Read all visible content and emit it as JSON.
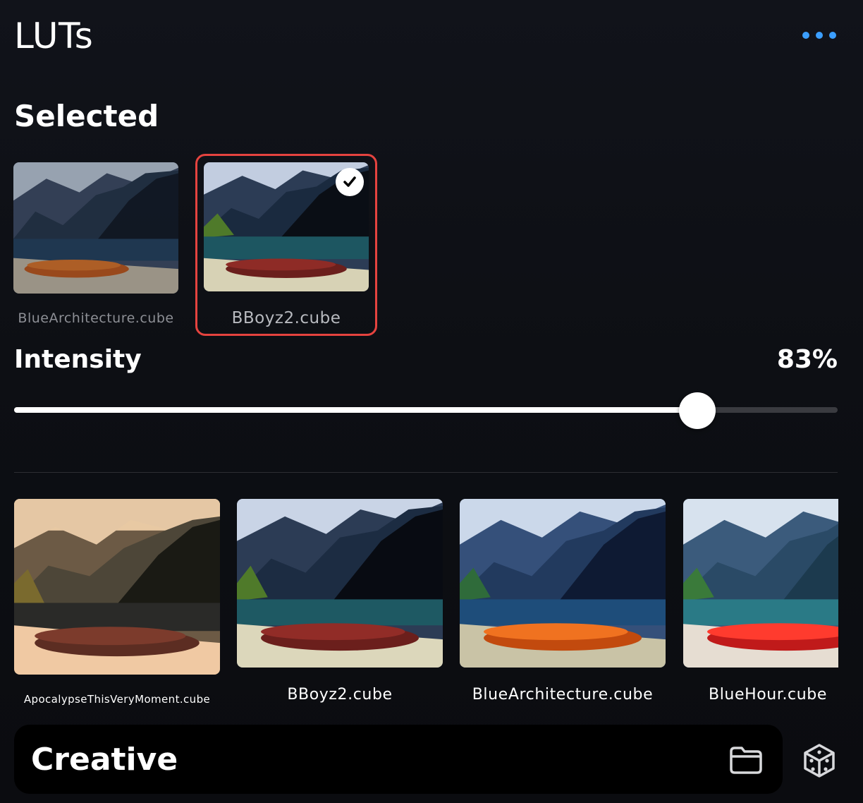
{
  "header": {
    "title": "LUTs",
    "more_icon": "ellipsis-icon"
  },
  "selected_section": {
    "title": "Selected",
    "items": [
      {
        "label": "BlueArchitecture.cube",
        "selected": false
      },
      {
        "label": "BBoyz2.cube",
        "selected": true
      }
    ]
  },
  "intensity": {
    "label": "Intensity",
    "value_text": "83%",
    "value": 0.83
  },
  "library": {
    "items": [
      {
        "label": "ApocalypseThisVeryMoment.cube"
      },
      {
        "label": "BBoyz2.cube"
      },
      {
        "label": "BlueArchitecture.cube"
      },
      {
        "label": "BlueHour.cube"
      }
    ]
  },
  "bottom_bar": {
    "title": "Creative",
    "folder_icon": "folder-icon",
    "cube_icon": "cube-icon"
  },
  "colors": {
    "accent": "#3b9eff",
    "selection_border": "#e5433f",
    "background": "#0d0f14"
  }
}
